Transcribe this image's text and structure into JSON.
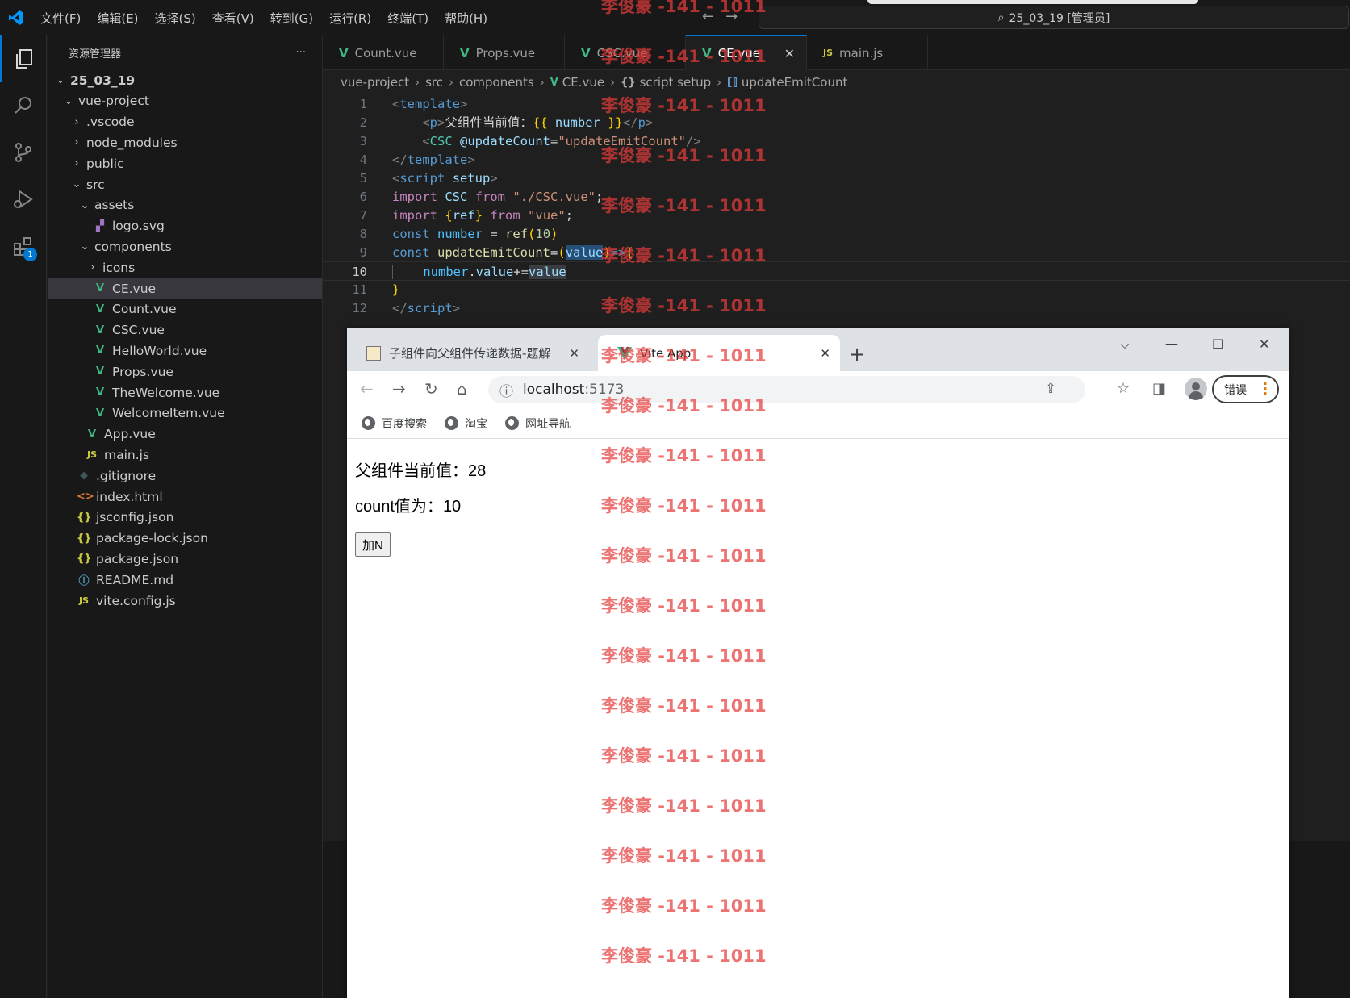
{
  "titlebar": {
    "menu": [
      "文件(F)",
      "编辑(E)",
      "选择(S)",
      "查看(V)",
      "转到(G)",
      "运行(R)",
      "终端(T)",
      "帮助(H)"
    ],
    "search_text": "25_03_19 [管理员]"
  },
  "activity": {
    "extensions_badge": "1"
  },
  "sidebar": {
    "title": "资源管理器",
    "more": "···",
    "tree": [
      {
        "label": "25_03_19",
        "type": "folder-open",
        "depth": 0
      },
      {
        "label": "vue-project",
        "type": "folder-open",
        "depth": 1
      },
      {
        "label": ".vscode",
        "type": "folder",
        "depth": 2
      },
      {
        "label": "node_modules",
        "type": "folder",
        "depth": 2
      },
      {
        "label": "public",
        "type": "folder",
        "depth": 2
      },
      {
        "label": "src",
        "type": "folder-open",
        "depth": 2
      },
      {
        "label": "assets",
        "type": "folder-open",
        "depth": 3
      },
      {
        "label": "logo.svg",
        "type": "svg",
        "depth": 4
      },
      {
        "label": "components",
        "type": "folder-open",
        "depth": 3
      },
      {
        "label": "icons",
        "type": "folder",
        "depth": 4
      },
      {
        "label": "CE.vue",
        "type": "vue",
        "depth": 4,
        "selected": true
      },
      {
        "label": "Count.vue",
        "type": "vue",
        "depth": 4
      },
      {
        "label": "CSC.vue",
        "type": "vue",
        "depth": 4
      },
      {
        "label": "HelloWorld.vue",
        "type": "vue",
        "depth": 4
      },
      {
        "label": "Props.vue",
        "type": "vue",
        "depth": 4
      },
      {
        "label": "TheWelcome.vue",
        "type": "vue",
        "depth": 4
      },
      {
        "label": "WelcomeItem.vue",
        "type": "vue",
        "depth": 4
      },
      {
        "label": "App.vue",
        "type": "vue",
        "depth": 3
      },
      {
        "label": "main.js",
        "type": "js",
        "depth": 3
      },
      {
        "label": ".gitignore",
        "type": "git",
        "depth": 2
      },
      {
        "label": "index.html",
        "type": "html",
        "depth": 2
      },
      {
        "label": "jsconfig.json",
        "type": "json",
        "depth": 2
      },
      {
        "label": "package-lock.json",
        "type": "json",
        "depth": 2
      },
      {
        "label": "package.json",
        "type": "json",
        "depth": 2
      },
      {
        "label": "README.md",
        "type": "info",
        "depth": 2
      },
      {
        "label": "vite.config.js",
        "type": "js",
        "depth": 2
      }
    ]
  },
  "editor": {
    "tabs": [
      {
        "label": "Count.vue",
        "icon": "vue"
      },
      {
        "label": "Props.vue",
        "icon": "vue"
      },
      {
        "label": "CSC.vue",
        "icon": "vue"
      },
      {
        "label": "CE.vue",
        "icon": "vue",
        "active": true
      },
      {
        "label": "main.js",
        "icon": "js"
      }
    ],
    "breadcrumb": [
      "vue-project",
      "src",
      "components",
      "CE.vue",
      "script setup",
      "updateEmitCount"
    ],
    "current_line": 10,
    "line_numbers": [
      "1",
      "2",
      "3",
      "4",
      "5",
      "6",
      "7",
      "8",
      "9",
      "10",
      "11",
      "12"
    ]
  },
  "browser": {
    "tabs": [
      {
        "label": "子组件向父组件传递数据-题解"
      },
      {
        "label": "Vite App",
        "active": true
      }
    ],
    "url_host": "localhost",
    "url_port": ":5173",
    "bookmarks": [
      "百度搜索",
      "淘宝",
      "网址导航"
    ],
    "error_button": "错误",
    "content": {
      "parent_label": "父组件当前值：",
      "parent_value": "28",
      "count_label": "count值为：",
      "count_value": "10",
      "add_button": "加N"
    }
  },
  "watermark": {
    "text": "李俊豪 -141 - 1011"
  }
}
